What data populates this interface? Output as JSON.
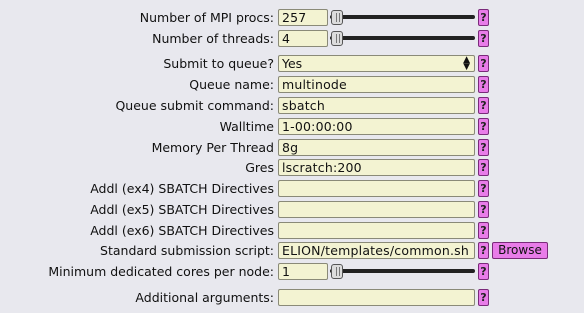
{
  "help_glyph": "?",
  "fields": {
    "mpi_procs": {
      "label": "Number of MPI procs:",
      "value": "257"
    },
    "threads": {
      "label": "Number of threads:",
      "value": "4"
    },
    "submit_queue": {
      "label": "Submit to queue?",
      "value": "Yes",
      "arrow_icon": "up-down-arrow-icon"
    },
    "queue_name": {
      "label": "Queue name:",
      "value": "multinode"
    },
    "submit_command": {
      "label": "Queue submit command:",
      "value": "sbatch"
    },
    "walltime": {
      "label": "Walltime",
      "value": "1-00:00:00"
    },
    "memory": {
      "label": "Memory Per Thread",
      "value": "8g"
    },
    "gres": {
      "label": "Gres",
      "value": "lscratch:200"
    },
    "addl4": {
      "label": "Addl (ex4) SBATCH Directives",
      "value": ""
    },
    "addl5": {
      "label": "Addl (ex5) SBATCH Directives",
      "value": ""
    },
    "addl6": {
      "label": "Addl (ex6) SBATCH Directives",
      "value": ""
    },
    "script": {
      "label": "Standard submission script:",
      "value": "ELION/templates/common.sh",
      "browse_label": "Browse"
    },
    "min_cores": {
      "label": "Minimum dedicated cores per node:",
      "value": "1"
    },
    "additional_args": {
      "label": "Additional arguments:",
      "value": ""
    }
  },
  "colors": {
    "help_button": "#e87ce8",
    "field_bg": "#f3f3d2",
    "page_bg": "#e8e8ee"
  }
}
